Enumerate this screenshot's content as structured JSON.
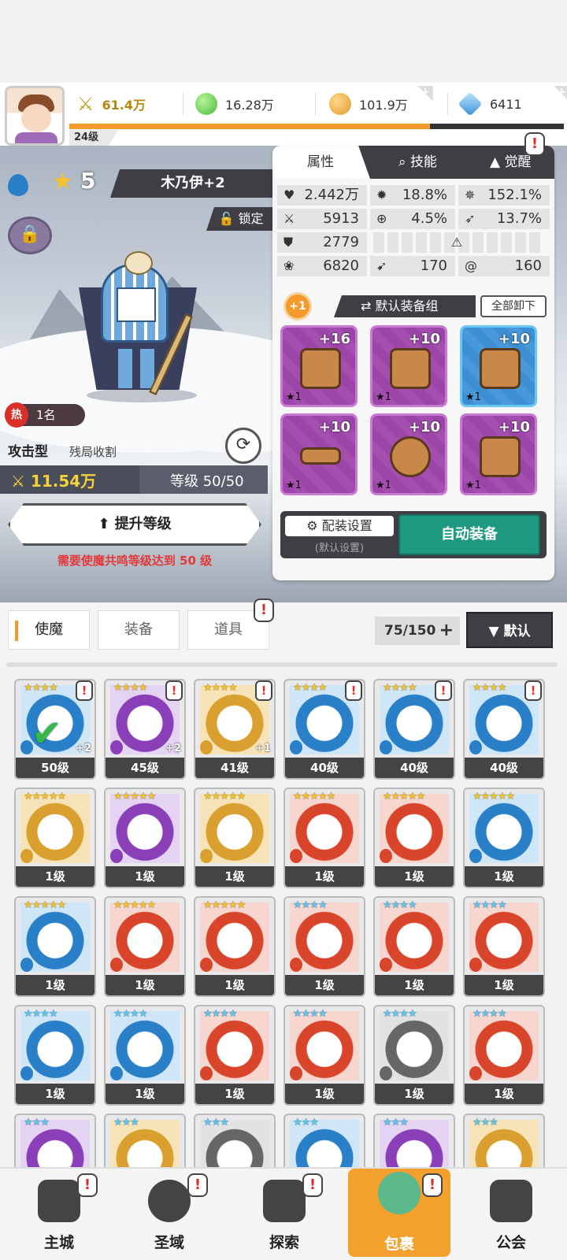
{
  "topbar": {
    "power": "61.4万",
    "jade": "16.28万",
    "gold": "101.9万",
    "gems": "6411",
    "player_level": "24级",
    "xp_progress": 0.73,
    "plus": "+"
  },
  "hero": {
    "stars": "5",
    "star_glyph": "★",
    "name": "木乃伊+2",
    "lock_label": "🔓 锁定",
    "hot_badge": "热",
    "hot_rank": "1名",
    "type": "攻击型",
    "role": "残局收割",
    "power": "11.54万",
    "level": "等级 50/50",
    "upgrade_label": "提升等级",
    "upgrade_arrow": "⬆",
    "warning": "需要使魔共鸣等级达到 50 级"
  },
  "panel": {
    "tabs": [
      "属性",
      "技能",
      "觉醒"
    ],
    "stats": {
      "hp": "2.442万",
      "crit": "18.8%",
      "crit_dmg": "152.1%",
      "atk": "5913",
      "hit": "4.5%",
      "speed": "13.7%",
      "def": "2779",
      "mp": "6820",
      "stat_a": "170",
      "stat_b": "160"
    },
    "set_badge": "+1",
    "set_name": "默认装备组",
    "unequip_all": "全部卸下",
    "equipment": [
      {
        "level": "+16",
        "count": "★1"
      },
      {
        "level": "+10",
        "count": "★1"
      },
      {
        "level": "+10",
        "count": "★1"
      },
      {
        "level": "+10",
        "count": "★1"
      },
      {
        "level": "+10",
        "count": "★1"
      },
      {
        "level": "+10",
        "count": "★1"
      }
    ],
    "config_label": "配装设置",
    "config_sub": "(默认设置)",
    "auto_equip": "自动装备"
  },
  "inventory": {
    "tabs": [
      "使魔",
      "装备",
      "道具"
    ],
    "count": "75/150",
    "count_plus": "+",
    "sort_label": "▼ 默认",
    "cards": [
      {
        "stars": "★★★★",
        "level": "50级",
        "plus": "+2",
        "tone": "blue"
      },
      {
        "stars": "★★★★",
        "level": "45级",
        "plus": "+2",
        "tone": "purple"
      },
      {
        "stars": "★★★★",
        "level": "41级",
        "plus": "+1",
        "tone": "gold"
      },
      {
        "stars": "★★★★",
        "level": "40级",
        "plus": "",
        "tone": "blue"
      },
      {
        "stars": "★★★★",
        "level": "40级",
        "plus": "",
        "tone": "blue"
      },
      {
        "stars": "★★★★",
        "level": "40级",
        "plus": "",
        "tone": "blue"
      },
      {
        "stars": "★★★★★",
        "level": "1级",
        "plus": "",
        "tone": "gold"
      },
      {
        "stars": "★★★★★",
        "level": "1级",
        "plus": "",
        "tone": "purple"
      },
      {
        "stars": "★★★★★",
        "level": "1级",
        "plus": "",
        "tone": "gold"
      },
      {
        "stars": "★★★★★",
        "level": "1级",
        "plus": "",
        "tone": "red"
      },
      {
        "stars": "★★★★★",
        "level": "1级",
        "plus": "",
        "tone": "red"
      },
      {
        "stars": "★★★★★",
        "level": "1级",
        "plus": "",
        "tone": "blue"
      },
      {
        "stars": "★★★★★",
        "level": "1级",
        "plus": "",
        "tone": "blue"
      },
      {
        "stars": "★★★★★",
        "level": "1级",
        "plus": "",
        "tone": "red"
      },
      {
        "stars": "★★★★★",
        "level": "1级",
        "plus": "",
        "tone": "red"
      },
      {
        "stars": "★★★★",
        "level": "1级",
        "plus": "",
        "tone": "red"
      },
      {
        "stars": "★★★★",
        "level": "1级",
        "plus": "",
        "tone": "red"
      },
      {
        "stars": "★★★★",
        "level": "1级",
        "plus": "",
        "tone": "red"
      },
      {
        "stars": "★★★★",
        "level": "1级",
        "plus": "",
        "tone": "blue"
      },
      {
        "stars": "★★★★",
        "level": "1级",
        "plus": "",
        "tone": "blue"
      },
      {
        "stars": "★★★★",
        "level": "1级",
        "plus": "",
        "tone": "red"
      },
      {
        "stars": "★★★★",
        "level": "1级",
        "plus": "",
        "tone": "red"
      },
      {
        "stars": "★★★★",
        "level": "1级",
        "plus": "",
        "tone": "gray"
      },
      {
        "stars": "★★★★",
        "level": "1级",
        "plus": "",
        "tone": "red"
      },
      {
        "stars": "★★★",
        "level": "",
        "plus": "",
        "tone": "purple"
      },
      {
        "stars": "★★★",
        "level": "",
        "plus": "",
        "tone": "gold"
      },
      {
        "stars": "★★★",
        "level": "",
        "plus": "",
        "tone": "gray"
      },
      {
        "stars": "★★★",
        "level": "",
        "plus": "",
        "tone": "blue"
      },
      {
        "stars": "★★★",
        "level": "",
        "plus": "",
        "tone": "purple"
      },
      {
        "stars": "★★★",
        "level": "",
        "plus": "",
        "tone": "gold"
      }
    ]
  },
  "nav": [
    "主城",
    "圣域",
    "探索",
    "包裹",
    "公会"
  ],
  "alert_glyph": "!",
  "colors": {
    "accent": "#f3a02c",
    "auto_equip": "#1f9a80",
    "dark_bar": "#3e3e44",
    "warning": "#e23a3a"
  }
}
